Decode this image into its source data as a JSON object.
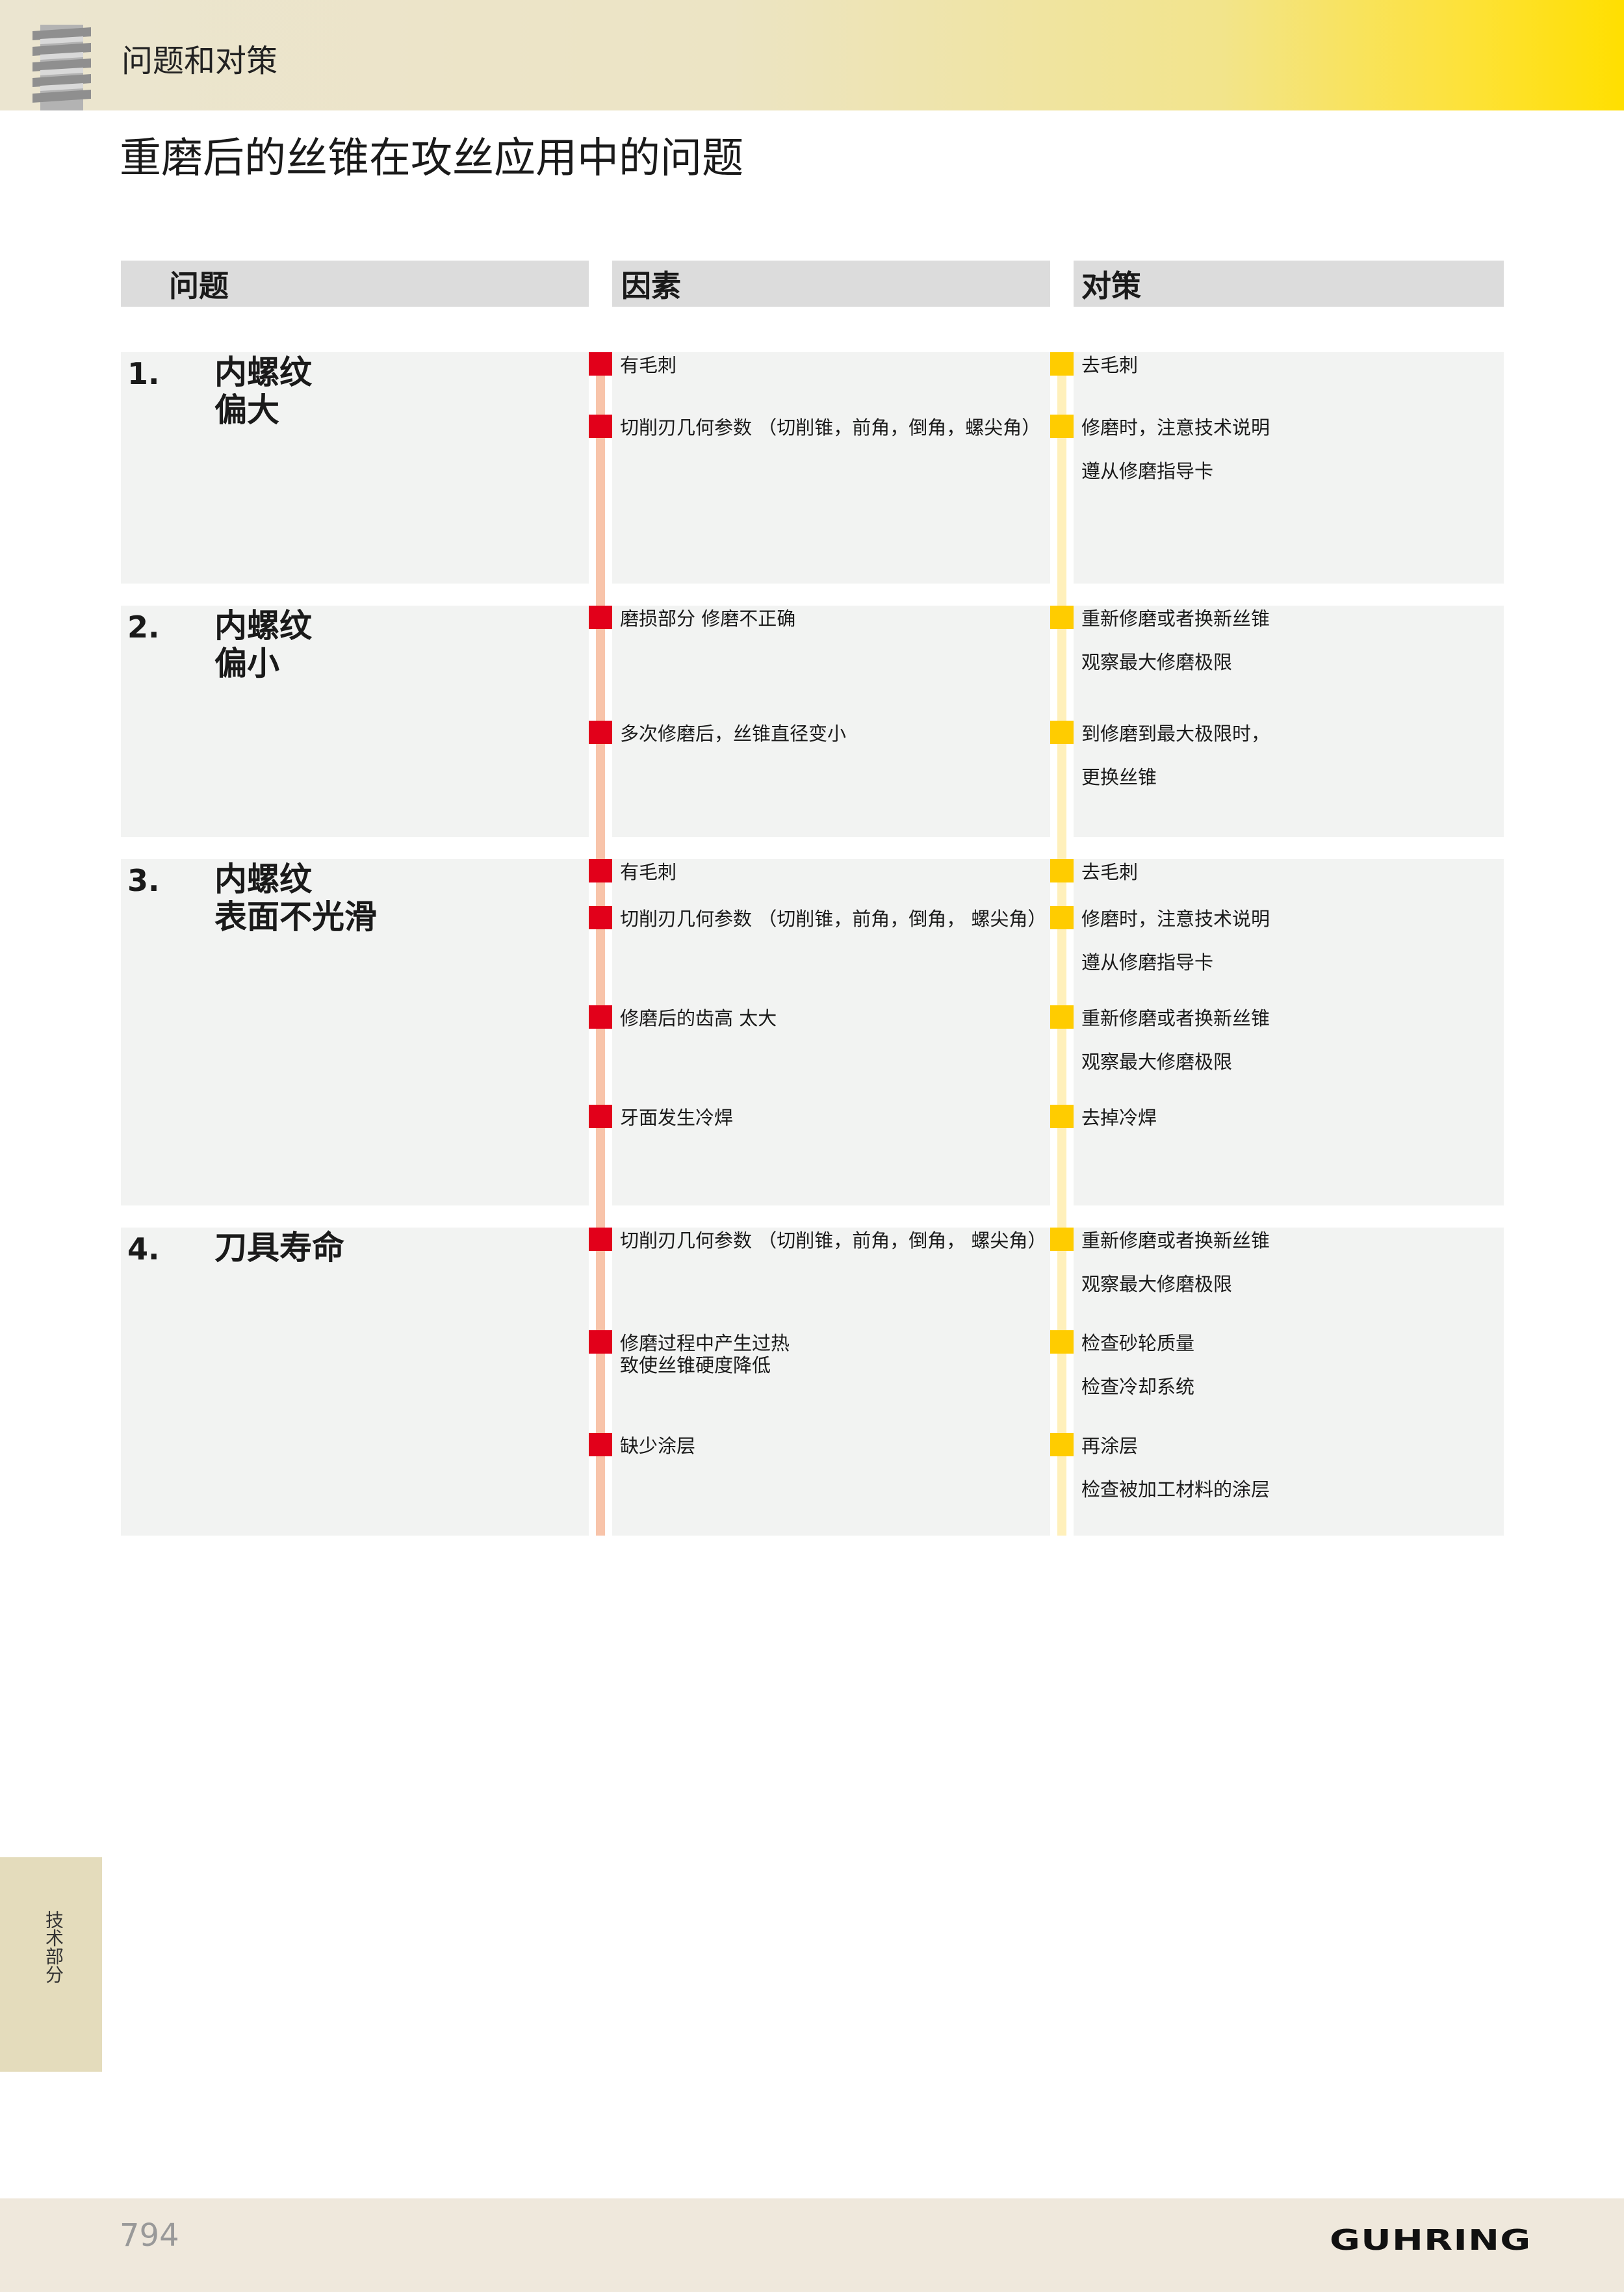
{
  "header": {
    "title": "问题和对策"
  },
  "page_title": "重磨后的丝锥在攻丝应用中的问题",
  "columns": {
    "problem": "问题",
    "cause": "因素",
    "remedy": "对策"
  },
  "rows": [
    {
      "num": "1.",
      "title_line1": "内螺纹",
      "title_line2": "偏大",
      "causes": [
        "有毛刺",
        "切削刃几何参数 （切削锥，前角，倒角，螺尖角）"
      ],
      "remedies": [
        "去毛刺",
        "修磨时，注意技术说明",
        "遵从修磨指导卡"
      ]
    },
    {
      "num": "2.",
      "title_line1": "内螺纹",
      "title_line2": "偏小",
      "causes": [
        "磨损部分 修磨不正确",
        "多次修磨后，丝锥直径变小"
      ],
      "remedies": [
        "重新修磨或者换新丝锥",
        "观察最大修磨极限",
        "到修磨到最大极限时，",
        "更换丝锥"
      ]
    },
    {
      "num": "3.",
      "title_line1": "内螺纹",
      "title_line2": "表面不光滑",
      "causes": [
        "有毛刺",
        "切削刃几何参数 （切削锥，前角，倒角， 螺尖角）",
        "修磨后的齿高 太大",
        "牙面发生冷焊"
      ],
      "remedies": [
        "去毛刺",
        "修磨时，注意技术说明",
        "遵从修磨指导卡",
        "重新修磨或者换新丝锥",
        "观察最大修磨极限",
        "去掉冷焊"
      ]
    },
    {
      "num": "4.",
      "title_line1": "刀具寿命",
      "title_line2": "",
      "causes": [
        "切削刃几何参数 （切削锥，前角，倒角， 螺尖角）",
        "修磨过程中产生过热",
        "致使丝锥硬度降低",
        "缺少涂层"
      ],
      "remedies": [
        "重新修磨或者换新丝锥",
        "观察最大修磨极限",
        "检查砂轮质量",
        "检查冷却系统",
        "再涂层",
        "检查被加工材料的涂层"
      ]
    }
  ],
  "side_tab": "技术部分",
  "footer": {
    "page_number": "794",
    "brand": "GUHRING"
  },
  "colors": {
    "cause_marker": "#e2001a",
    "remedy_marker": "#ffcc00",
    "header_accent": "#ffdf00"
  },
  "icons": {
    "header": "thread-screw-icon"
  }
}
